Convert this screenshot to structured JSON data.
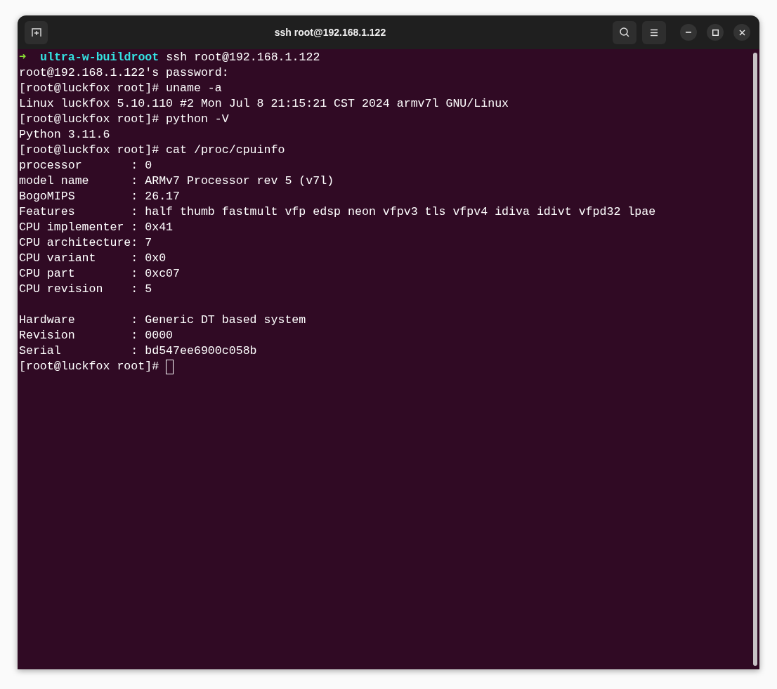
{
  "window": {
    "title": "ssh root@192.168.1.122"
  },
  "terminal": {
    "lines": [
      {
        "kind": "zsh",
        "arrow": "➜",
        "dir": "ultra-w-buildroot",
        "text": "ssh root@192.168.1.122"
      },
      {
        "kind": "output",
        "text": "root@192.168.1.122's password:"
      },
      {
        "kind": "output",
        "text": "[root@luckfox root]# uname -a"
      },
      {
        "kind": "output",
        "text": "Linux luckfox 5.10.110 #2 Mon Jul 8 21:15:21 CST 2024 armv7l GNU/Linux"
      },
      {
        "kind": "output",
        "text": "[root@luckfox root]# python -V"
      },
      {
        "kind": "output",
        "text": "Python 3.11.6"
      },
      {
        "kind": "output",
        "text": "[root@luckfox root]# cat /proc/cpuinfo"
      },
      {
        "kind": "output",
        "text": "processor       : 0"
      },
      {
        "kind": "output",
        "text": "model name      : ARMv7 Processor rev 5 (v7l)"
      },
      {
        "kind": "output",
        "text": "BogoMIPS        : 26.17"
      },
      {
        "kind": "output",
        "text": "Features        : half thumb fastmult vfp edsp neon vfpv3 tls vfpv4 idiva idivt vfpd32 lpae"
      },
      {
        "kind": "output",
        "text": "CPU implementer : 0x41"
      },
      {
        "kind": "output",
        "text": "CPU architecture: 7"
      },
      {
        "kind": "output",
        "text": "CPU variant     : 0x0"
      },
      {
        "kind": "output",
        "text": "CPU part        : 0xc07"
      },
      {
        "kind": "output",
        "text": "CPU revision    : 5"
      },
      {
        "kind": "blank"
      },
      {
        "kind": "output",
        "text": "Hardware        : Generic DT based system"
      },
      {
        "kind": "output",
        "text": "Revision        : 0000"
      },
      {
        "kind": "output",
        "text": "Serial          : bd547ee6900c058b"
      },
      {
        "kind": "prompt",
        "text": "[root@luckfox root]#",
        "cursor": true
      }
    ]
  }
}
